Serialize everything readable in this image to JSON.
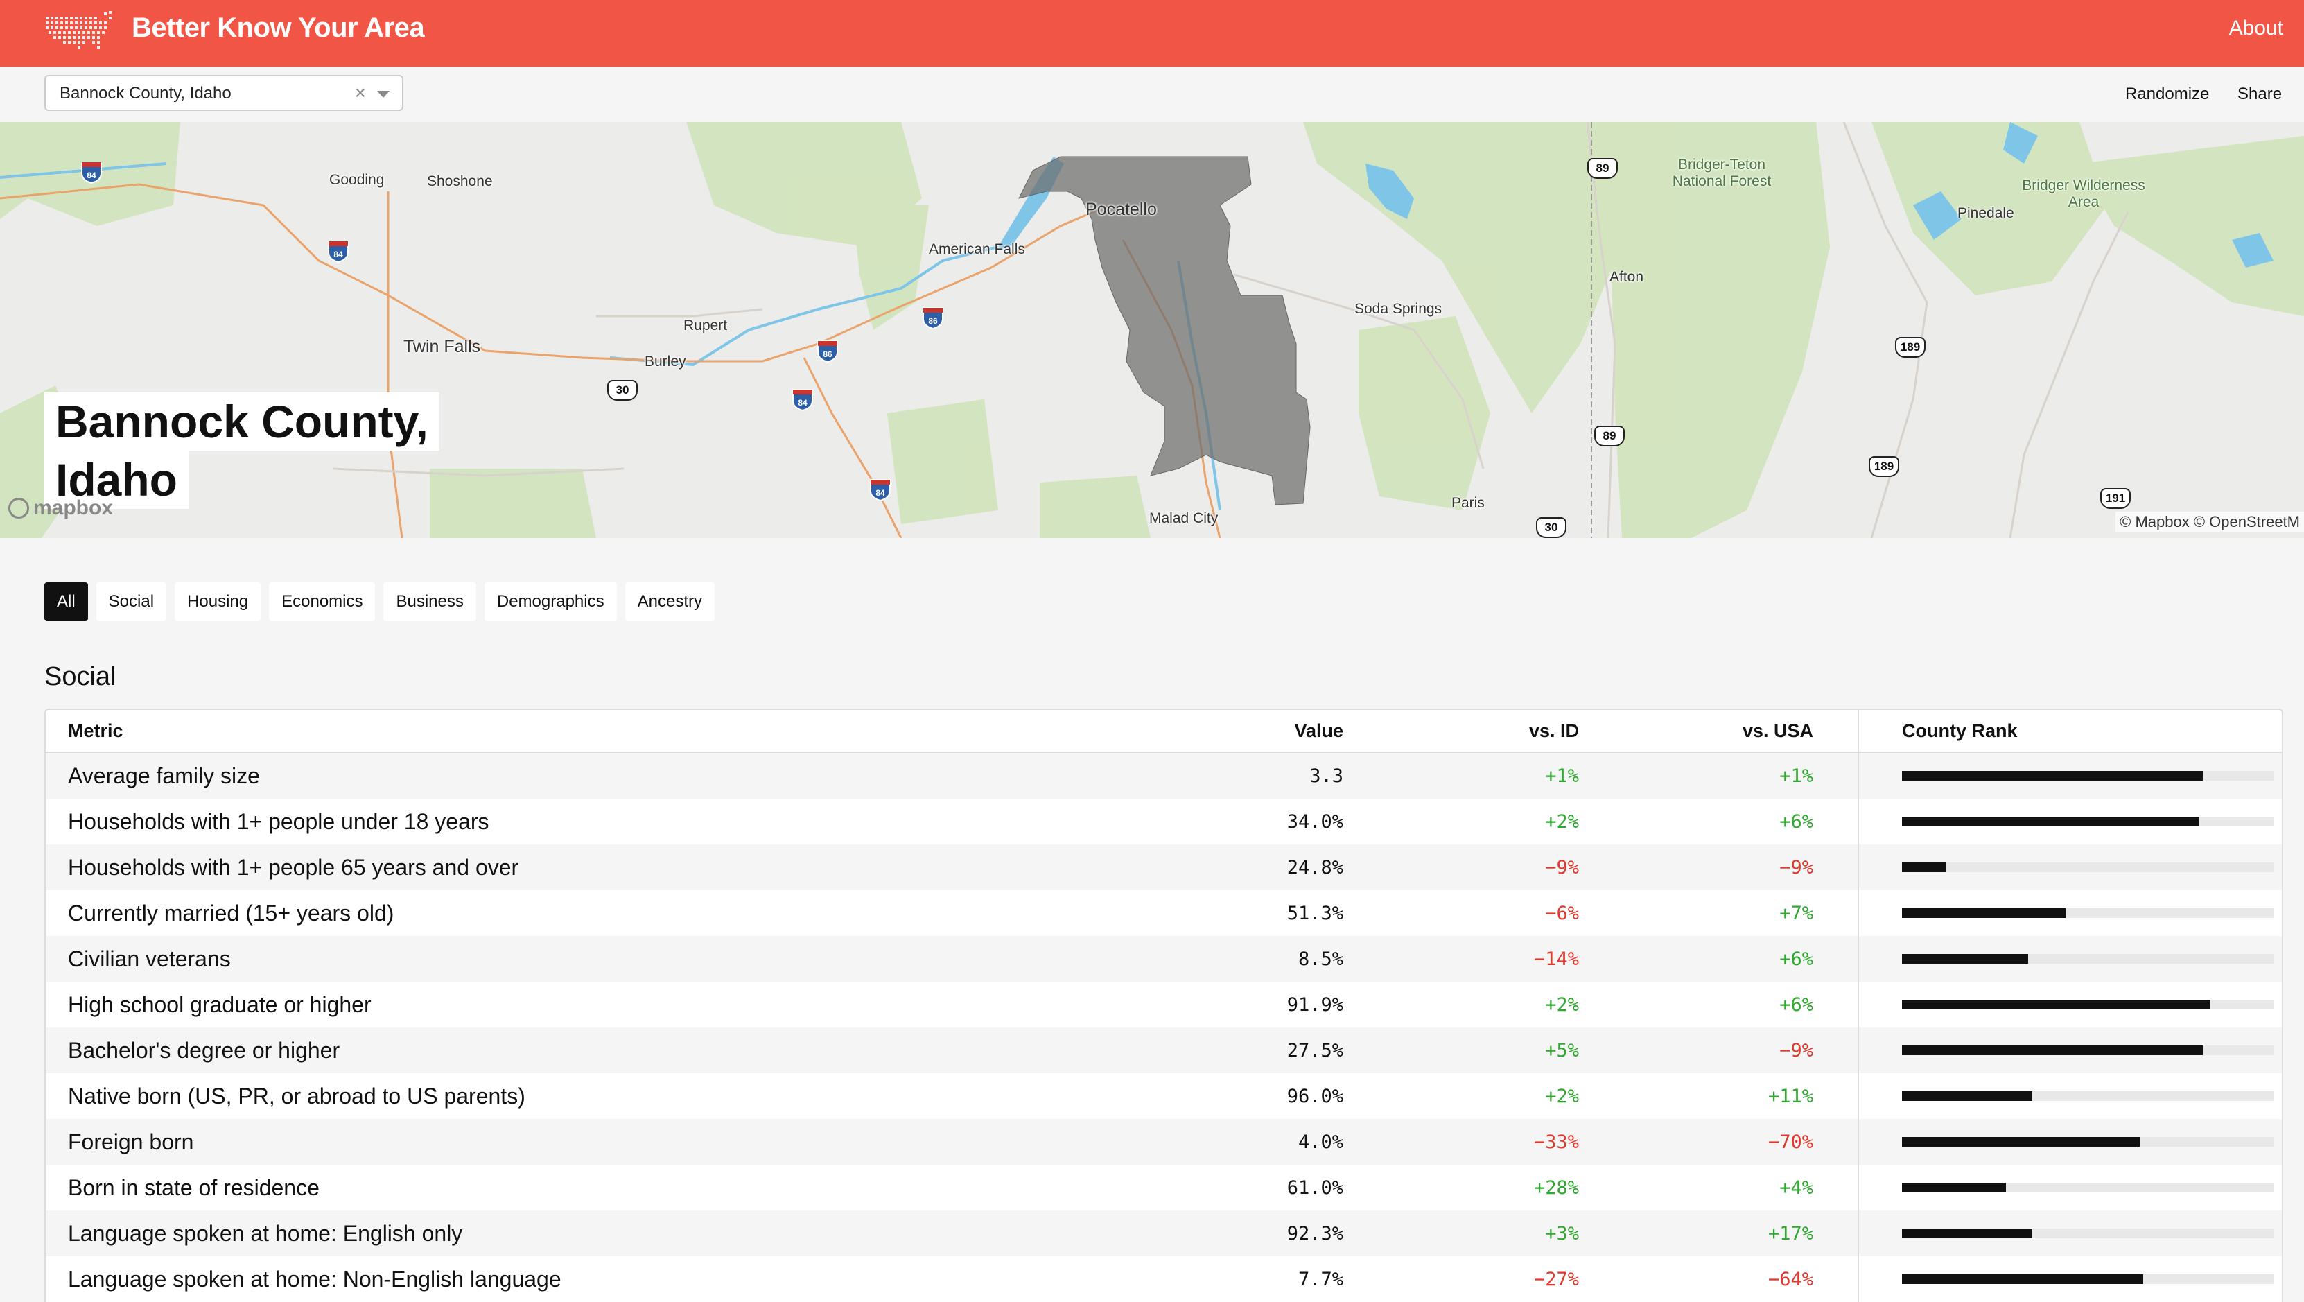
{
  "header": {
    "brand": "Better Know Your Area",
    "about": "About",
    "logo_icon": "us-map-dots-icon"
  },
  "toolbar": {
    "selected_county": "Bannock County, Idaho",
    "clear_glyph": "×",
    "randomize": "Randomize",
    "share": "Share"
  },
  "map": {
    "title_line1": "Bannock County,",
    "title_line2": "Idaho",
    "mapbox_logo": "mapbox",
    "attribution": "© Mapbox © OpenStreetM",
    "places": [
      "Gooding",
      "Shoshone",
      "American Falls",
      "Pocatello",
      "Rupert",
      "Twin Falls",
      "Burley",
      "Soda Springs",
      "Malad City",
      "Paris",
      "Afton",
      "Pinedale",
      "Bridger-Teton National Forest",
      "Bridger Wilderness Area"
    ],
    "interstates": [
      "84",
      "84",
      "86",
      "86",
      "84",
      "84"
    ],
    "us_routes": [
      "30",
      "89",
      "89",
      "189",
      "189",
      "191",
      "30"
    ]
  },
  "tabs": [
    "All",
    "Social",
    "Housing",
    "Economics",
    "Business",
    "Demographics",
    "Ancestry"
  ],
  "active_tab": "All",
  "section": {
    "title": "Social",
    "columns": {
      "metric": "Metric",
      "value": "Value",
      "vs_state": "vs. ID",
      "vs_usa": "vs. USA",
      "rank": "County Rank"
    },
    "rows": [
      {
        "metric": "Average family size",
        "value": "3.3",
        "vs_id": "+1%",
        "vs_usa": "+1%",
        "rank": 0.81
      },
      {
        "metric": "Households with 1+ people under 18 years",
        "value": "34.0%",
        "vs_id": "+2%",
        "vs_usa": "+6%",
        "rank": 0.8
      },
      {
        "metric": "Households with 1+ people 65 years and over",
        "value": "24.8%",
        "vs_id": "−9%",
        "vs_usa": "−9%",
        "rank": 0.12
      },
      {
        "metric": "Currently married (15+ years old)",
        "value": "51.3%",
        "vs_id": "−6%",
        "vs_usa": "+7%",
        "rank": 0.44
      },
      {
        "metric": "Civilian veterans",
        "value": "8.5%",
        "vs_id": "−14%",
        "vs_usa": "+6%",
        "rank": 0.34
      },
      {
        "metric": "High school graduate or higher",
        "value": "91.9%",
        "vs_id": "+2%",
        "vs_usa": "+6%",
        "rank": 0.83
      },
      {
        "metric": "Bachelor's degree or higher",
        "value": "27.5%",
        "vs_id": "+5%",
        "vs_usa": "−9%",
        "rank": 0.81
      },
      {
        "metric": "Native born (US, PR, or abroad to US parents)",
        "value": "96.0%",
        "vs_id": "+2%",
        "vs_usa": "+11%",
        "rank": 0.35
      },
      {
        "metric": "Foreign born",
        "value": "4.0%",
        "vs_id": "−33%",
        "vs_usa": "−70%",
        "rank": 0.64
      },
      {
        "metric": "Born in state of residence",
        "value": "61.0%",
        "vs_id": "+28%",
        "vs_usa": "+4%",
        "rank": 0.28
      },
      {
        "metric": "Language spoken at home: English only",
        "value": "92.3%",
        "vs_id": "+3%",
        "vs_usa": "+17%",
        "rank": 0.35
      },
      {
        "metric": "Language spoken at home: Non-English language",
        "value": "7.7%",
        "vs_id": "−27%",
        "vs_usa": "−64%",
        "rank": 0.65
      }
    ]
  }
}
